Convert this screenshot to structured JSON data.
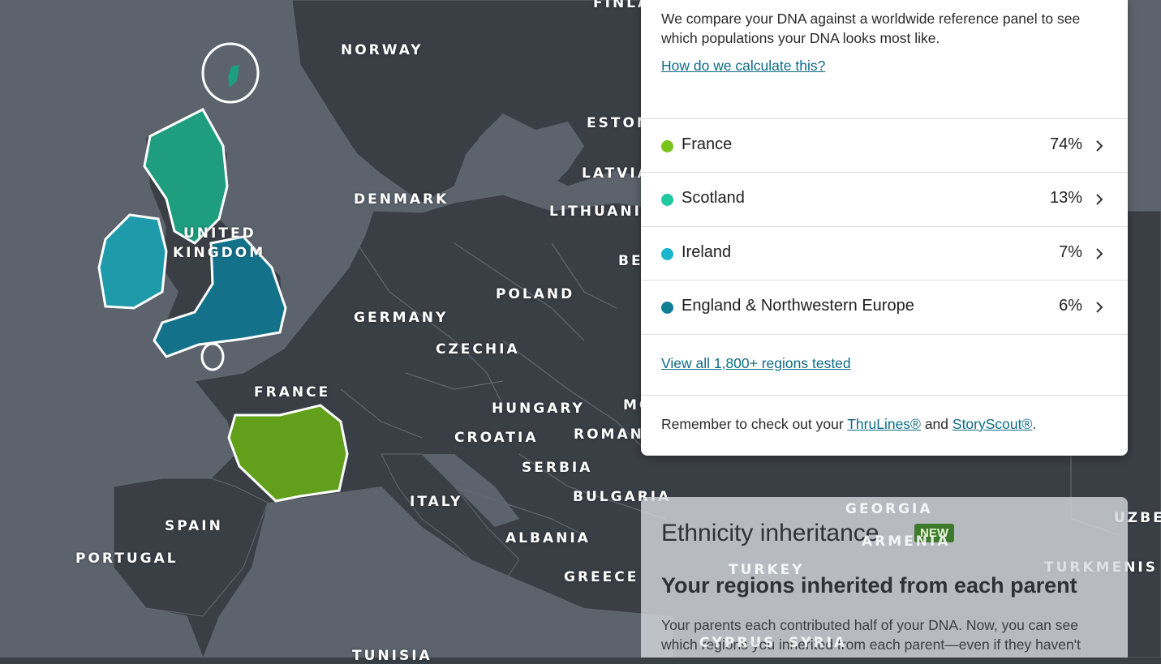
{
  "map": {
    "labels": {
      "finland": "FINLAND",
      "norway": "NORWAY",
      "estonia": "ESTONIA",
      "latvia": "LATVIA",
      "lithuania": "LITHUANIA",
      "denmark": "DENMARK",
      "united": "UNITED",
      "kingdom": "KINGDOM",
      "belarus": "BE",
      "poland": "POLAND",
      "germany": "GERMANY",
      "czechia": "CZECHIA",
      "france": "FRANCE",
      "hungary": "HUNGARY",
      "moldova": "MO",
      "croatia": "CROATIA",
      "romania": "ROMAN",
      "serbia": "SERBIA",
      "italy": "ITALY",
      "bulgaria": "BULGARIA",
      "spain": "SPAIN",
      "portugal": "PORTUGAL",
      "albania": "ALBANIA",
      "greece": "GREECE",
      "tunisia": "TUNISIA"
    },
    "background_labels": {
      "georgia": "GEORGIA",
      "armenia": "ARMENIA",
      "turkey": "TURKEY",
      "turkmenistan": "TURKMENIS",
      "uzbekistan": "UZBE",
      "cyprus": "CYPRUS",
      "syria": "SYRIA"
    },
    "region_colors": {
      "france": "#62a01c",
      "scotland": "#1f9e7f",
      "ireland": "#1f9aaa",
      "england": "#13728a"
    }
  },
  "ethnicity": {
    "intro": "We compare your DNA against a worldwide reference panel to see which populations your DNA looks most like.",
    "calc_link": "How do we calculate this?",
    "regions": [
      {
        "name": "France",
        "percent": "74%",
        "color": "#7ac21c"
      },
      {
        "name": "Scotland",
        "percent": "13%",
        "color": "#1fc8a0"
      },
      {
        "name": "Ireland",
        "percent": "7%",
        "color": "#1ab5cc"
      },
      {
        "name": "England & Northwestern Europe",
        "percent": "6%",
        "color": "#0f7f96"
      }
    ],
    "view_all": "View all 1,800+ regions tested",
    "reminder_prefix": "Remember to check out your ",
    "thrulines": "ThruLines®",
    "reminder_and": " and ",
    "storyscout": "StoryScout®",
    "reminder_suffix": "."
  },
  "inheritance": {
    "title": "Ethnicity inheritance",
    "badge": "NEW",
    "subtitle": "Your regions inherited from each parent",
    "description": "Your parents each contributed half of your DNA. Now, you can see which regions you inherited from each parent—even if they haven't taken"
  },
  "icons": {
    "chevron": "chevron-right-icon"
  }
}
